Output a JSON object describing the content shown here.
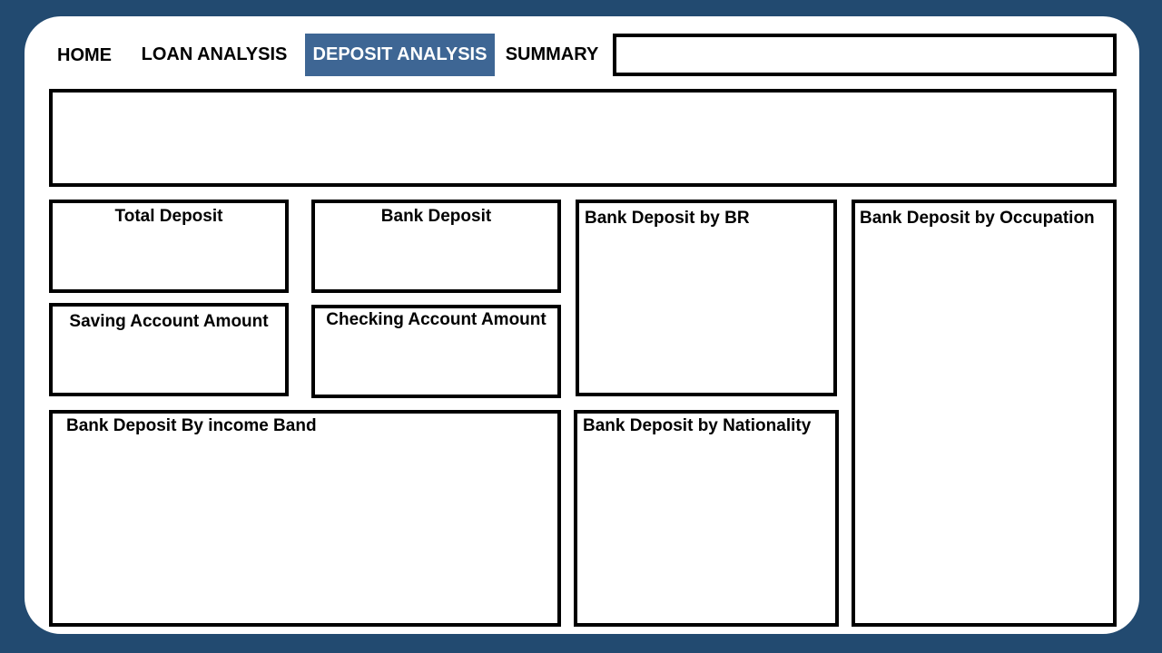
{
  "nav": {
    "items": [
      {
        "label": "HOME",
        "active": false
      },
      {
        "label": "LOAN ANALYSIS",
        "active": false
      },
      {
        "label": "DEPOSIT ANALYSIS",
        "active": true
      },
      {
        "label": "SUMMARY",
        "active": false
      }
    ],
    "search_value": ""
  },
  "banner": {
    "content": ""
  },
  "panels": {
    "total_deposit": "Total Deposit",
    "bank_deposit": "Bank Deposit",
    "bank_deposit_by_br": "Bank Deposit by BR",
    "bank_deposit_by_occupation": "Bank Deposit by Occupation",
    "saving_account_amount": "Saving Account Amount",
    "checking_account_amount": "Checking Account Amount",
    "bank_deposit_by_income_band": "Bank Deposit By income Band",
    "bank_deposit_by_nationality": "Bank Deposit by Nationality"
  },
  "colors": {
    "background": "#224A70",
    "active_tab": "#3E6694",
    "border": "#000000"
  }
}
